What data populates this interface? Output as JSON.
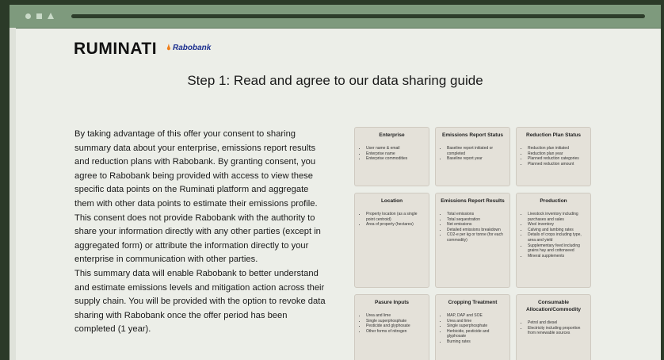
{
  "brand": {
    "logo": "RUMINATI",
    "partner": "Rabobank",
    "partner_mark": "🌢"
  },
  "heading": "Step 1: Read and agree to our data sharing guide",
  "body": [
    "By taking advantage of this offer your consent to sharing summary data about your enterprise, emissions report results and reduction plans with Rabobank. By granting consent, you agree to Rabobank being provided with access to view these specific data points on the Ruminati platform and aggregate them with other data points to estimate their emissions profile. This consent does not provide Rabobank with the authority to share your information directly with any other parties (except in aggregated form) or attribute the information directly to your enterprise in communication with other parties.",
    "This summary data will enable Rabobank to better understand and estimate emissions levels and mitigation action across their supply chain. You will be provided with the option to revoke data sharing with Rabobank once the offer period has been completed (1 year)."
  ],
  "cards": [
    {
      "title": "Enterprise",
      "items": [
        "User name & email",
        "Enterprise name",
        "Enterprise commodities"
      ]
    },
    {
      "title": "Emissions Report Status",
      "items": [
        "Baseline report initiated or completed",
        "Baseline report year"
      ]
    },
    {
      "title": "Reduction Plan Status",
      "items": [
        "Reduction plan initiated",
        "Reduction plan year",
        "Planned reduction categories",
        "Planned reduction amount"
      ]
    },
    {
      "title": "Location",
      "items": [
        "Property location (as a single point centroid)",
        "Area of property (hectares)"
      ]
    },
    {
      "title": "Emissions Report Results",
      "items": [
        "Total emissions",
        "Total sequestration",
        "Net emissions",
        "Detailed emissions breakdown",
        "CO2-e per kg or tonne (for each commodity)"
      ]
    },
    {
      "title": "Production",
      "items": [
        "Livestock inventory including purchases and sales",
        "Wool inventory",
        "Calving and lambing rates",
        "Details of crops including type, area and yield",
        "Supplementary feed including grains hay and cottonseed",
        "Mineral supplements"
      ]
    },
    {
      "title": "Pasure Inputs",
      "items": [
        "Urea and lime",
        "Single superphosphate",
        "Pesticide and glyphosate",
        "Other forms of nitrogen"
      ]
    },
    {
      "title": "Cropping Treatment",
      "items": [
        "MAP, DAP and SOE",
        "Urea and lime",
        "Single superphosphate",
        "Herbicide, pesticide and glyphosate",
        "Burning rates"
      ]
    },
    {
      "title": "Consumable Allocation/Commodity",
      "items": [
        "Petrol and diesel",
        "Electricity including proportion from renewable sources"
      ]
    }
  ]
}
